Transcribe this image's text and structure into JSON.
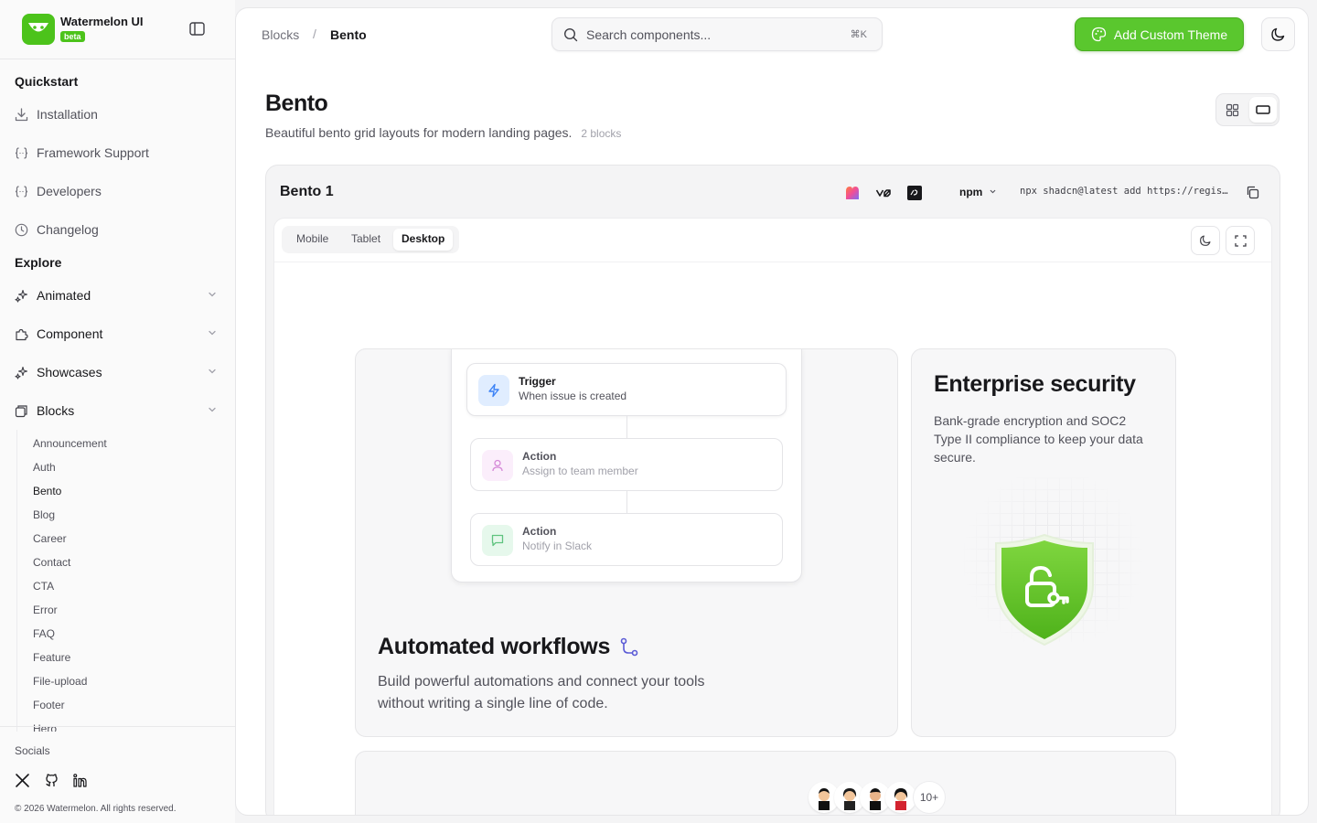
{
  "sidebar": {
    "brand": "Watermelon UI",
    "badge": "beta",
    "sections": {
      "quickstart": "Quickstart",
      "explore": "Explore"
    },
    "quickstart_items": [
      {
        "label": "Installation",
        "icon": "download-icon"
      },
      {
        "label": "Framework Support",
        "icon": "braces-icon"
      },
      {
        "label": "Developers",
        "icon": "braces-icon"
      },
      {
        "label": "Changelog",
        "icon": "clock-icon"
      }
    ],
    "explore_items": [
      {
        "label": "Animated",
        "icon": "sparkles-icon"
      },
      {
        "label": "Component",
        "icon": "puzzle-icon"
      },
      {
        "label": "Showcases",
        "icon": "sparkles-icon"
      },
      {
        "label": "Blocks",
        "icon": "blocks-icon"
      }
    ],
    "blocks_sub": [
      "Announcement",
      "Auth",
      "Bento",
      "Blog",
      "Career",
      "Contact",
      "CTA",
      "Error",
      "FAQ",
      "Feature",
      "File-upload",
      "Footer",
      "Hero"
    ],
    "active_sub": "Bento",
    "footer": {
      "socials_label": "Socials",
      "copyright": "© 2026 Watermelon. All rights reserved."
    }
  },
  "header": {
    "breadcrumb": [
      "Blocks",
      "Bento"
    ],
    "separator": "/",
    "search_placeholder": "Search components...",
    "search_shortcut": "⌘K",
    "add_theme_label": "Add Custom Theme"
  },
  "page": {
    "title": "Bento",
    "description": "Beautiful bento grid layouts for modern landing pages.",
    "count": "2 blocks"
  },
  "block": {
    "title": "Bento 1",
    "package_manager": "npm",
    "install_cmd": "npx shadcn@latest add https://regis…",
    "tabs": [
      "Mobile",
      "Tablet",
      "Desktop"
    ],
    "active_tab": "Desktop"
  },
  "preview": {
    "workflow": [
      {
        "title": "Trigger",
        "subtitle": "When issue is created"
      },
      {
        "title": "Action",
        "subtitle": "Assign to team member"
      },
      {
        "title": "Action",
        "subtitle": "Notify in Slack"
      }
    ],
    "automated_title": "Automated workflows",
    "automated_desc": "Build powerful automations and connect your tools without writing a single line of code.",
    "security_title": "Enterprise security",
    "security_desc": "Bank-grade encryption and SOC2 Type II compliance to keep your data secure.",
    "team_more": "10+"
  },
  "colors": {
    "brand_green": "#5ac72e",
    "accent_blue": "#3b82f6"
  }
}
